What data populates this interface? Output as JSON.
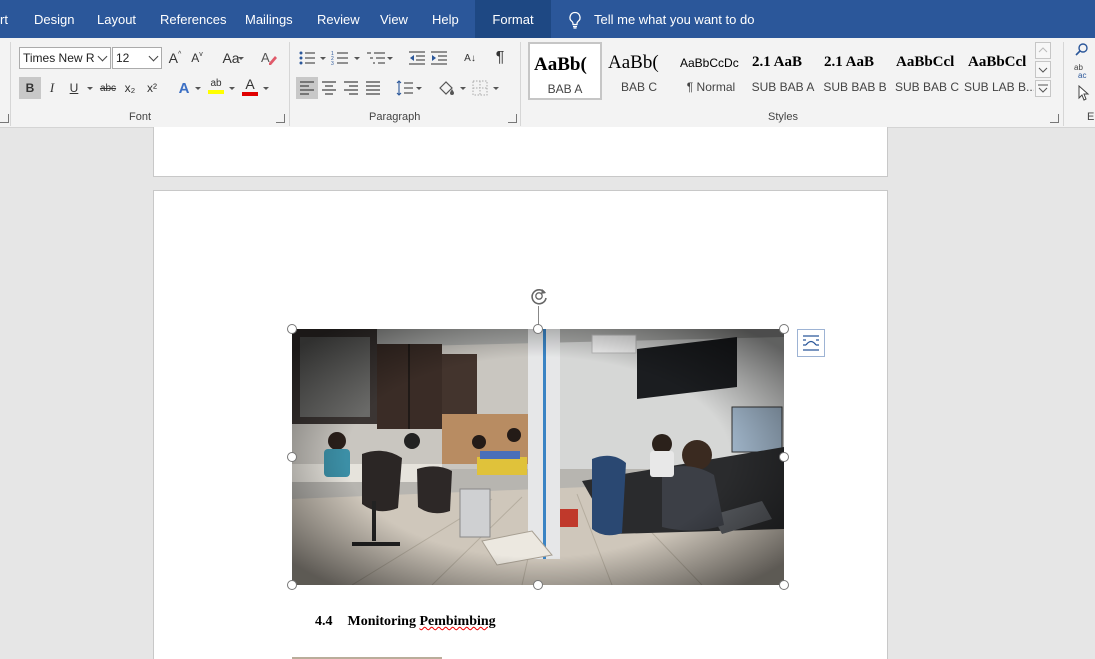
{
  "menu": {
    "items": [
      {
        "label": "rt"
      },
      {
        "label": "Design"
      },
      {
        "label": "Layout"
      },
      {
        "label": "References"
      },
      {
        "label": "Mailings"
      },
      {
        "label": "Review"
      },
      {
        "label": "View"
      },
      {
        "label": "Help"
      },
      {
        "label": "Format"
      }
    ],
    "active": "Format",
    "tell_me": "Tell me what you want to do"
  },
  "ribbon": {
    "font": {
      "name": "Times New R",
      "size": "12",
      "group_label": "Font",
      "change_case": "Aa",
      "bold": "B",
      "italic": "I",
      "underline": "U",
      "strikethrough": "abc",
      "subscript": "x₂",
      "superscript": "x²",
      "grow": "A",
      "shrink": "A",
      "text_effects": "A",
      "highlight": "ab",
      "font_color": "A"
    },
    "paragraph": {
      "group_label": "Paragraph",
      "sort": "A↓",
      "show_marks": "¶"
    },
    "styles": {
      "group_label": "Styles",
      "items": [
        {
          "preview": "AaBb(",
          "name": "BAB A"
        },
        {
          "preview": "AaBb(",
          "name": "BAB C"
        },
        {
          "preview": "AaBbCcDc",
          "name": "¶ Normal"
        },
        {
          "preview": "2.1 AaB",
          "name": "SUB BAB A"
        },
        {
          "preview": "2.1 AaB",
          "name": "SUB BAB B"
        },
        {
          "preview": "AaBbCcl",
          "name": "SUB BAB C"
        },
        {
          "preview": "AaBbCcl",
          "name": "SUB LAB B..."
        }
      ]
    },
    "editing": {
      "replace_hint": "ab ac",
      "partial_label": "E"
    }
  },
  "document": {
    "heading_number": "4.4",
    "heading_text_a": "Monitoring ",
    "heading_text_b": "Pembimbing",
    "photo_alt": "Office room with people working at computers"
  },
  "colors": {
    "menubar": "#2b579a",
    "highlight_bar": "#ffff00",
    "font_color_bar": "#e00000",
    "spell_error": "#e00000"
  }
}
